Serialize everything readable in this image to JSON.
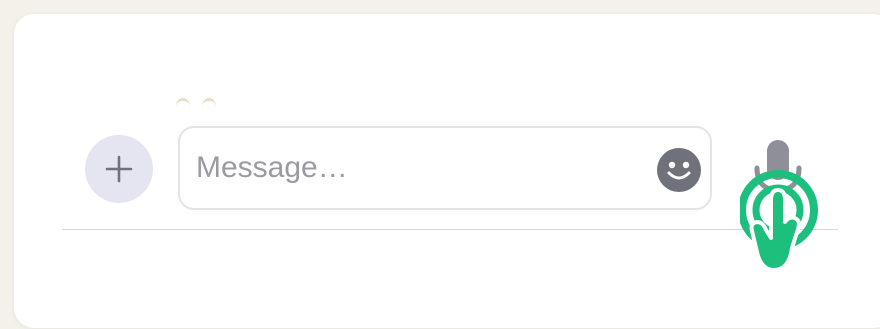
{
  "composer": {
    "message_placeholder": "Message…",
    "message_value": ""
  },
  "icons": {
    "add": "plus-icon",
    "emoji": "smiley-face-icon",
    "mic": "microphone-icon",
    "tap_hint": "tap-gesture-icon"
  },
  "colors": {
    "background": "#f4f0ea",
    "card": "#ffffff",
    "add_button_bg": "#e4e5f0",
    "icon_gray": "#6f717b",
    "mic_gray": "#8e8f99",
    "tap_hint_green": "#1dbf7c",
    "placeholder": "#9a9aa3"
  }
}
